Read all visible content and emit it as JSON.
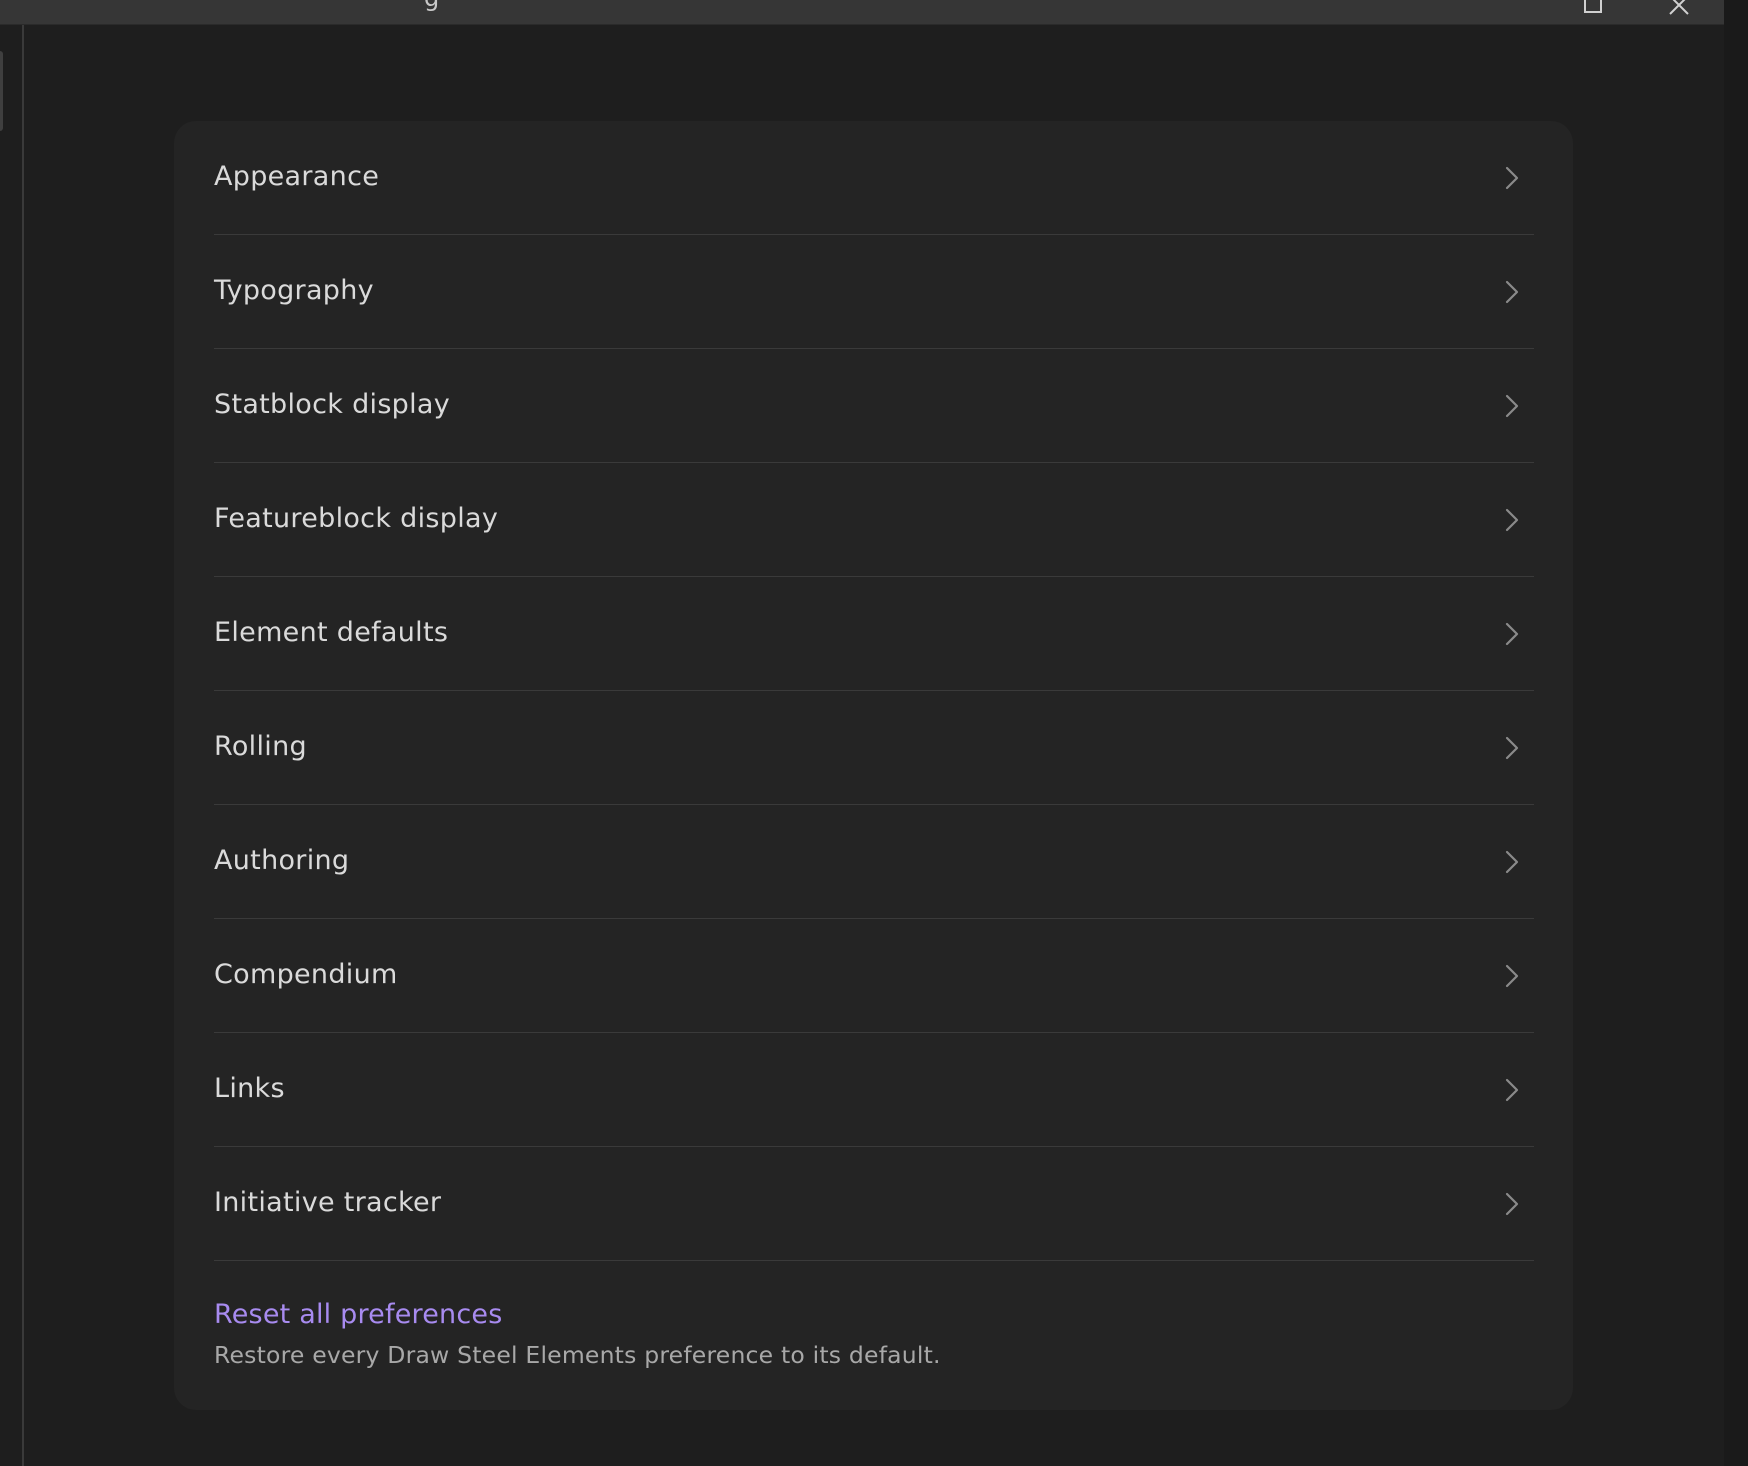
{
  "titlebar": {
    "title_fragment": "g"
  },
  "menu": {
    "items": [
      {
        "label": "Appearance"
      },
      {
        "label": "Typography"
      },
      {
        "label": "Statblock display"
      },
      {
        "label": "Featureblock display"
      },
      {
        "label": "Element defaults"
      },
      {
        "label": "Rolling"
      },
      {
        "label": "Authoring"
      },
      {
        "label": "Compendium"
      },
      {
        "label": "Links"
      },
      {
        "label": "Initiative tracker"
      }
    ]
  },
  "reset": {
    "link_label": "Reset all preferences",
    "description": "Restore every Draw Steel Elements preference to its default."
  },
  "colors": {
    "background": "#1e1e1e",
    "card": "#242424",
    "accent_link": "#a88bf0",
    "divider": "#3a3a3a"
  },
  "icons": {
    "menu_item_trailing": "chevron-right-icon",
    "window_maximize": "maximize-icon",
    "window_close": "close-icon"
  }
}
